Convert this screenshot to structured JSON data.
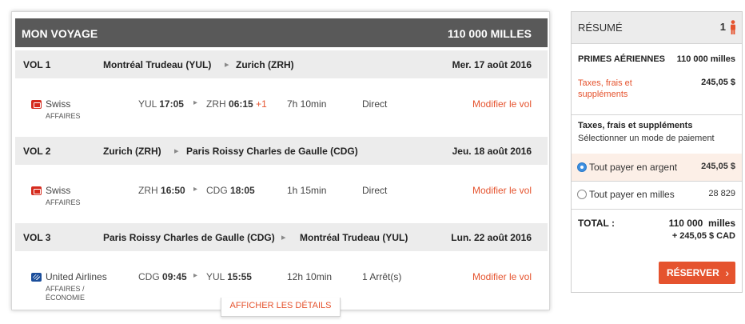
{
  "trip": {
    "title": "MON VOYAGE",
    "total_miles": "110 000 MILLES",
    "legs": [
      {
        "label": "VOL 1",
        "origin": "Montréal Trudeau (YUL)",
        "destination": "Zurich (ZRH)",
        "date": "Mer. 17 août 2016",
        "carrier": "Swiss",
        "logo": "swiss",
        "cabin": "AFFAIRES",
        "dep_code": "YUL",
        "dep_time": "17:05",
        "arr_code": "ZRH",
        "arr_time": "06:15",
        "arr_plus": "+1",
        "duration": "7h 10min",
        "stops": "Direct",
        "modify": "Modifier le vol"
      },
      {
        "label": "VOL 2",
        "origin": "Zurich (ZRH)",
        "destination": "Paris Roissy Charles de Gaulle (CDG)",
        "date": "Jeu. 18 août 2016",
        "carrier": "Swiss",
        "logo": "swiss",
        "cabin": "AFFAIRES",
        "dep_code": "ZRH",
        "dep_time": "16:50",
        "arr_code": "CDG",
        "arr_time": "18:05",
        "arr_plus": "",
        "duration": "1h 15min",
        "stops": "Direct",
        "modify": "Modifier le vol"
      },
      {
        "label": "VOL 3",
        "origin": "Paris Roissy Charles de Gaulle (CDG)",
        "destination": "Montréal Trudeau (YUL)",
        "date": "Lun. 22 août 2016",
        "carrier": "United Airlines",
        "logo": "united",
        "cabin_line1": "AFFAIRES /",
        "cabin_line2": "ÉCONOMIE",
        "dep_code": "CDG",
        "dep_time": "09:45",
        "arr_code": "YUL",
        "arr_time": "15:55",
        "arr_plus": "",
        "duration": "12h 10min",
        "stops": "1 Arrêt(s)",
        "modify": "Modifier le vol"
      }
    ],
    "details_link": "AFFICHER LES DÉTAILS"
  },
  "summary": {
    "title": "RÉSUMÉ",
    "passenger_count": "1",
    "award_label": "PRIMES AÉRIENNES",
    "award_value": "110 000 milles",
    "taxes_label": "Taxes, frais et suppléments",
    "taxes_value": "245,05 $",
    "taxes_section_title": "Taxes, frais et suppléments",
    "payment_prompt": "Sélectionner un mode de paiement",
    "pay_cash_label": "Tout payer en argent",
    "pay_cash_value": "245,05 $",
    "pay_miles_label": "Tout payer en milles",
    "pay_miles_value": "28 829",
    "total_label": "TOTAL :",
    "total_miles": "110 000  milles",
    "total_cash": "+ 245,05 $ CAD",
    "reserve_label": "RÉSERVER",
    "selected_payment": "cash"
  },
  "colors": {
    "accent": "#e5532e",
    "header_bg": "#595959",
    "row_bg": "#ececec",
    "radio_selected": "#3d8fe0"
  }
}
